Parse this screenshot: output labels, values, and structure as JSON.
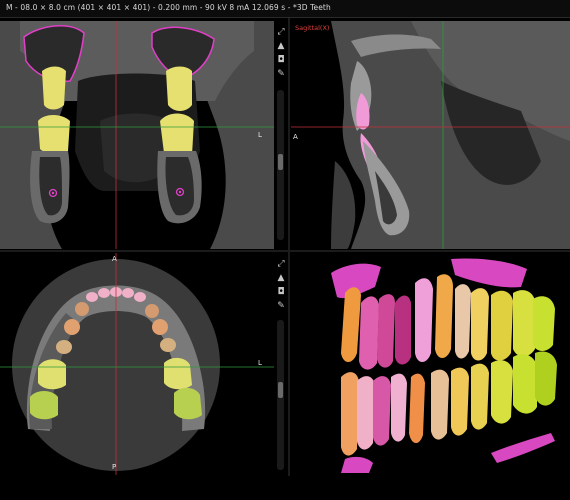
{
  "header": {
    "info": "M - 08.0 × 8.0 cm (401 × 401 × 401) - 0.200 mm - 90 kV 8 mA 12.069 s - *3D Teeth"
  },
  "views": {
    "coronal": {
      "side_label": "L"
    },
    "sagittal": {
      "title": "Sagittal(X)",
      "side_label": "A"
    },
    "axial": {
      "top_label": "A",
      "bottom_label": "P",
      "side_label": "L"
    },
    "render3d": {}
  },
  "toolbar_top": [
    {
      "name": "expand-icon",
      "glyph": "⤢"
    },
    {
      "name": "warning-icon",
      "glyph": "▲"
    },
    {
      "name": "camera-icon",
      "glyph": "◘"
    },
    {
      "name": "wrench-icon",
      "glyph": "✎"
    }
  ],
  "toolbar_bottom": [
    {
      "name": "expand-icon",
      "glyph": "⤢"
    },
    {
      "name": "warning-icon",
      "glyph": "▲"
    },
    {
      "name": "camera-icon",
      "glyph": "◘"
    },
    {
      "name": "wrench-icon",
      "glyph": "✎"
    }
  ],
  "colors": {
    "crosshair_red": "#c0303a",
    "crosshair_green": "#2f9a3a",
    "tooth_yellow": "#e6e070",
    "tooth_pink": "#f09ad8",
    "tooth_magenta": "#e040c8",
    "tooth_orange": "#f09a40",
    "tooth_lime": "#c8e030"
  }
}
